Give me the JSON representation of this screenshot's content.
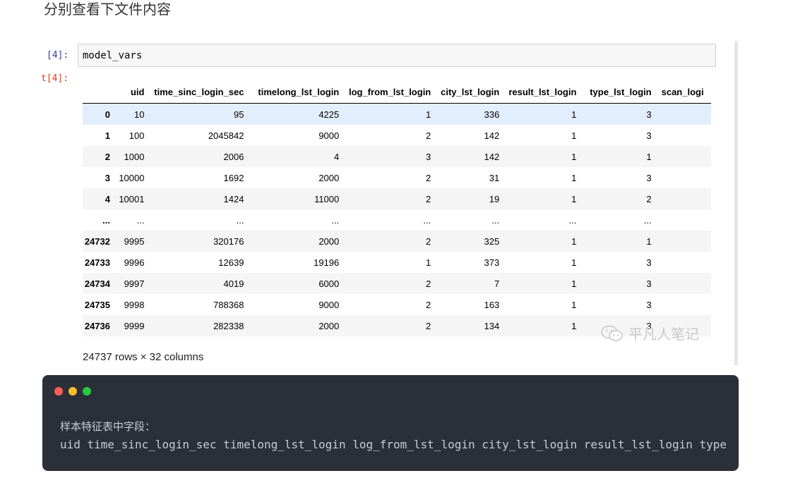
{
  "heading": "分别查看下文件内容",
  "input_cell": {
    "prompt": "[4]:",
    "code": "model_vars"
  },
  "output_cell": {
    "prompt": "t[4]:"
  },
  "table": {
    "columns": [
      "uid",
      "time_sinc_login_sec",
      "timelong_lst_login",
      "log_from_lst_login",
      "city_lst_login",
      "result_lst_login",
      "type_lst_login",
      "scan_logi"
    ],
    "rows": [
      {
        "index": "0",
        "cells": [
          "10",
          "95",
          "4225",
          "1",
          "336",
          "1",
          "3",
          ""
        ]
      },
      {
        "index": "1",
        "cells": [
          "100",
          "2045842",
          "9000",
          "2",
          "142",
          "1",
          "3",
          ""
        ]
      },
      {
        "index": "2",
        "cells": [
          "1000",
          "2006",
          "4",
          "3",
          "142",
          "1",
          "1",
          ""
        ]
      },
      {
        "index": "3",
        "cells": [
          "10000",
          "1692",
          "2000",
          "2",
          "31",
          "1",
          "3",
          ""
        ]
      },
      {
        "index": "4",
        "cells": [
          "10001",
          "1424",
          "11000",
          "2",
          "19",
          "1",
          "2",
          ""
        ]
      },
      {
        "index": "...",
        "cells": [
          "...",
          "...",
          "...",
          "...",
          "...",
          "...",
          "...",
          ""
        ]
      },
      {
        "index": "24732",
        "cells": [
          "9995",
          "320176",
          "2000",
          "2",
          "325",
          "1",
          "1",
          ""
        ]
      },
      {
        "index": "24733",
        "cells": [
          "9996",
          "12639",
          "19196",
          "1",
          "373",
          "1",
          "3",
          ""
        ]
      },
      {
        "index": "24734",
        "cells": [
          "9997",
          "4019",
          "6000",
          "2",
          "7",
          "1",
          "3",
          ""
        ]
      },
      {
        "index": "24735",
        "cells": [
          "9998",
          "788368",
          "9000",
          "2",
          "163",
          "1",
          "3",
          ""
        ]
      },
      {
        "index": "24736",
        "cells": [
          "9999",
          "282338",
          "2000",
          "2",
          "134",
          "1",
          "3",
          ""
        ]
      }
    ]
  },
  "shape_info": "24737 rows × 32 columns",
  "watermark": "平凡人笔记",
  "code_block": {
    "line1": "样本特征表中字段：",
    "line2": "uid time_sinc_login_sec timelong_lst_login log_from_lst_login city_lst_login result_lst_login type"
  },
  "colors": {
    "dot_red": "#ff5f56",
    "dot_yellow": "#ffbd2e",
    "dot_green": "#27c93f",
    "code_bg": "#2b2f38"
  }
}
